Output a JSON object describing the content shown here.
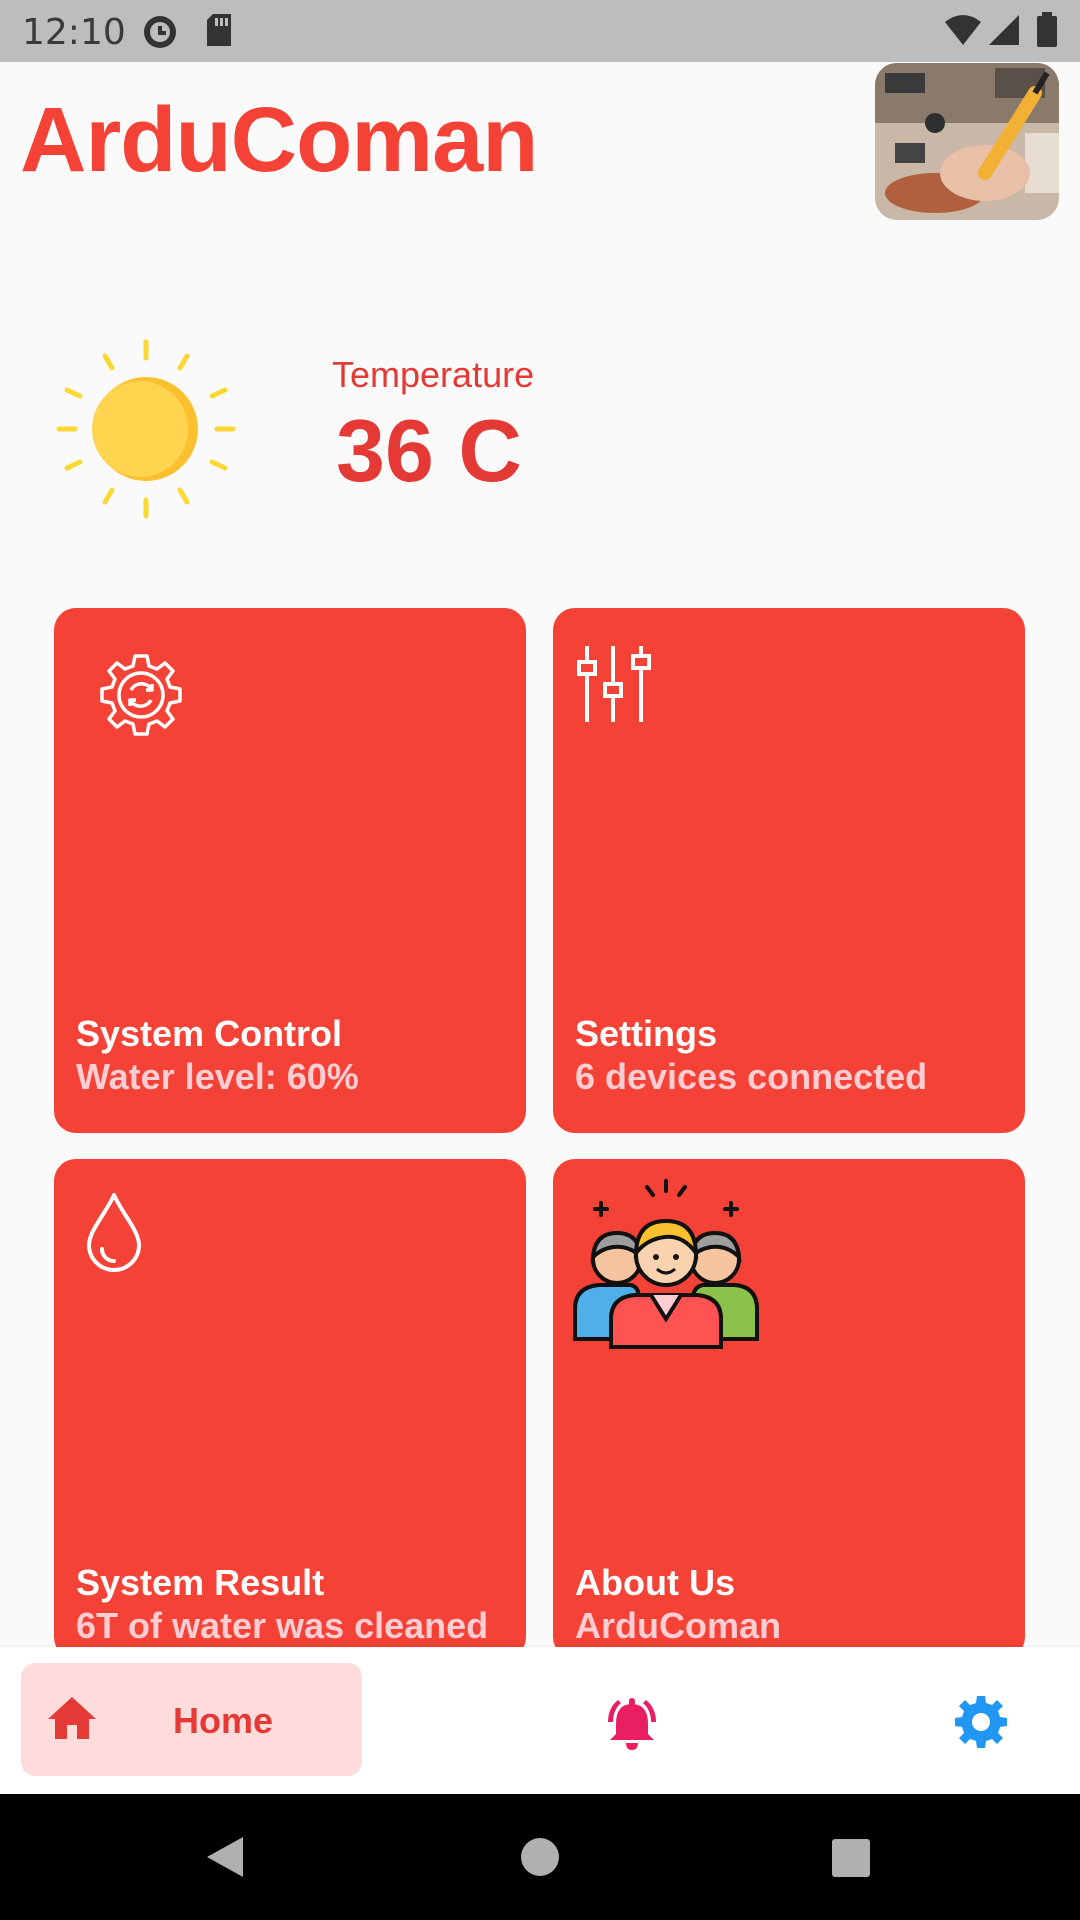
{
  "status_bar": {
    "time": "12:10",
    "icons": [
      "alarm-clock-icon",
      "sd-card-icon",
      "wifi-icon",
      "cell-signal-icon",
      "battery-icon"
    ]
  },
  "header": {
    "title": "ArduComan",
    "avatar": "soldering-photo"
  },
  "weather": {
    "icon": "sun-icon",
    "label": "Temperature",
    "value": "36 C"
  },
  "cards": [
    {
      "title": "System Control",
      "subtitle": "Water level: 60%",
      "icon": "gear-sync-icon"
    },
    {
      "title": "Settings",
      "subtitle": "6 devices connected",
      "icon": "sliders-icon"
    },
    {
      "title": "System Result",
      "subtitle": "6T of water was cleaned",
      "icon": "water-drop-icon"
    },
    {
      "title": "About Us",
      "subtitle": "ArduComan",
      "icon": "team-icon"
    }
  ],
  "bottom_nav": {
    "items": [
      {
        "label": "Home",
        "icon": "home-icon",
        "active": true
      },
      {
        "label": "",
        "icon": "bell-icon",
        "active": false
      },
      {
        "label": "",
        "icon": "gear-icon",
        "active": false
      }
    ]
  },
  "colors": {
    "accent": "#f44336",
    "card_subtitle": "#ffcdd2",
    "nav_active_bg": "#ffdcdc",
    "bell": "#e91e63",
    "settings_gear": "#2196f3"
  }
}
